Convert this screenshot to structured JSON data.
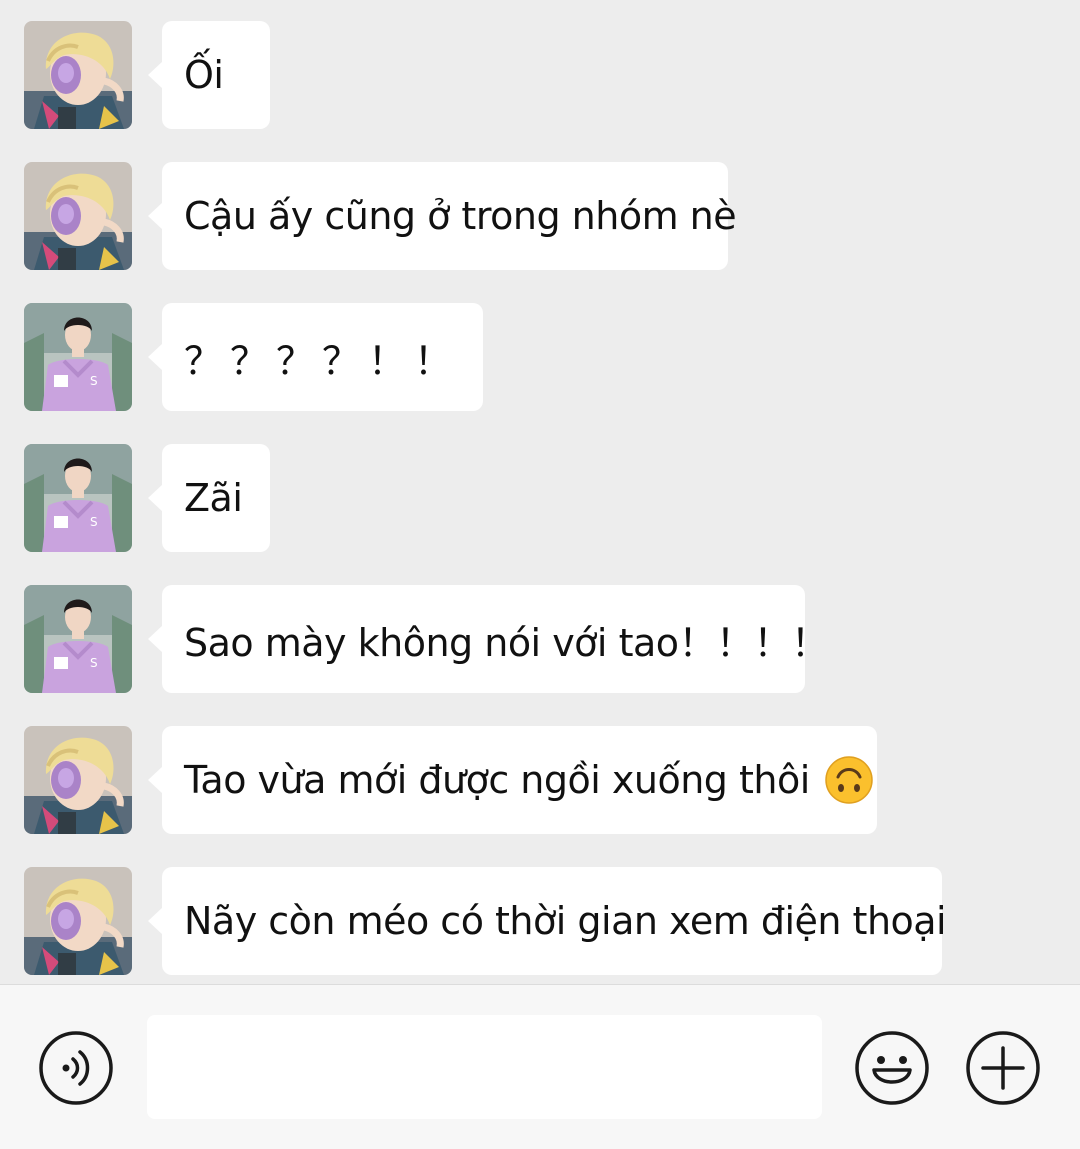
{
  "messages": [
    {
      "sender": "blonde",
      "text": "Ối"
    },
    {
      "sender": "blonde",
      "text": "Cậu ấy cũng ở trong nhóm nè"
    },
    {
      "sender": "purple",
      "text": "？？？？！！"
    },
    {
      "sender": "purple",
      "text": "Zãi"
    },
    {
      "sender": "purple",
      "text": "Sao mày không nói với tao！！！！"
    },
    {
      "sender": "blonde",
      "text": "Tao vừa mới được ngồi xuống thôi",
      "emoji": "upside-down-face"
    },
    {
      "sender": "blonde",
      "text": "Nãy còn méo có thời gian xem điện thoại"
    }
  ],
  "input": {
    "value": "",
    "voice_icon": "voice-icon",
    "emoji_icon": "emoji-icon",
    "plus_icon": "plus-icon"
  },
  "colors": {
    "background": "#ededed",
    "bubble": "#ffffff",
    "input_bar": "#f7f7f7",
    "icon": "#1a1a1a"
  }
}
